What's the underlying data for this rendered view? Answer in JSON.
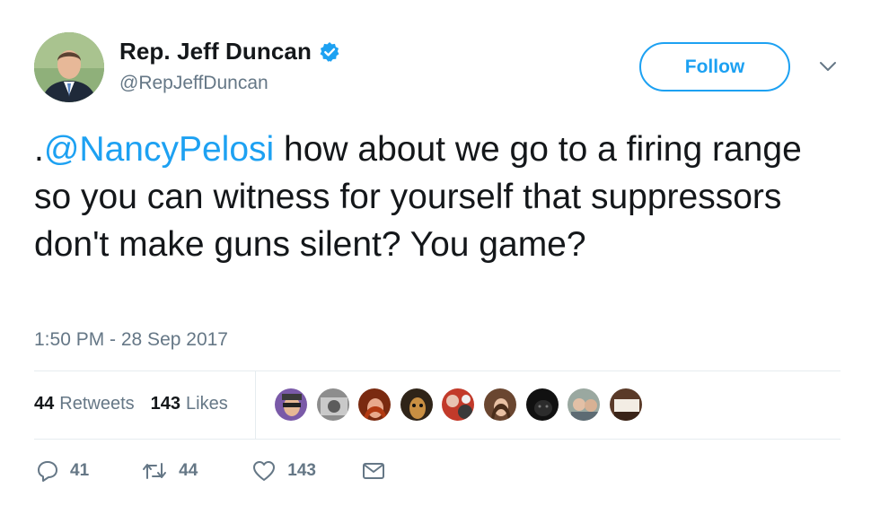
{
  "author": {
    "name": "Rep. Jeff Duncan",
    "handle": "@RepJeffDuncan"
  },
  "follow_label": "Follow",
  "tweet": {
    "prefix": ".",
    "mention": "@NancyPelosi",
    "text": " how about we go to a firing range so you can witness for yourself that suppressors don't make guns silent? You game?"
  },
  "timestamp": "1:50 PM - 28 Sep 2017",
  "stats": {
    "retweets_count": "44",
    "retweets_label": "Retweets",
    "likes_count": "143",
    "likes_label": "Likes"
  },
  "actions": {
    "reply_count": "41",
    "retweet_count": "44",
    "like_count": "143"
  },
  "colors": {
    "accent": "#1da1f2",
    "secondary_text": "#657786",
    "primary_text": "#14171a",
    "divider": "#e6ecf0"
  },
  "icons": [
    "verified-icon",
    "caret-down-icon",
    "reply-icon",
    "retweet-icon",
    "like-icon",
    "direct-message-icon"
  ],
  "liked_by_avatar_count": 9
}
